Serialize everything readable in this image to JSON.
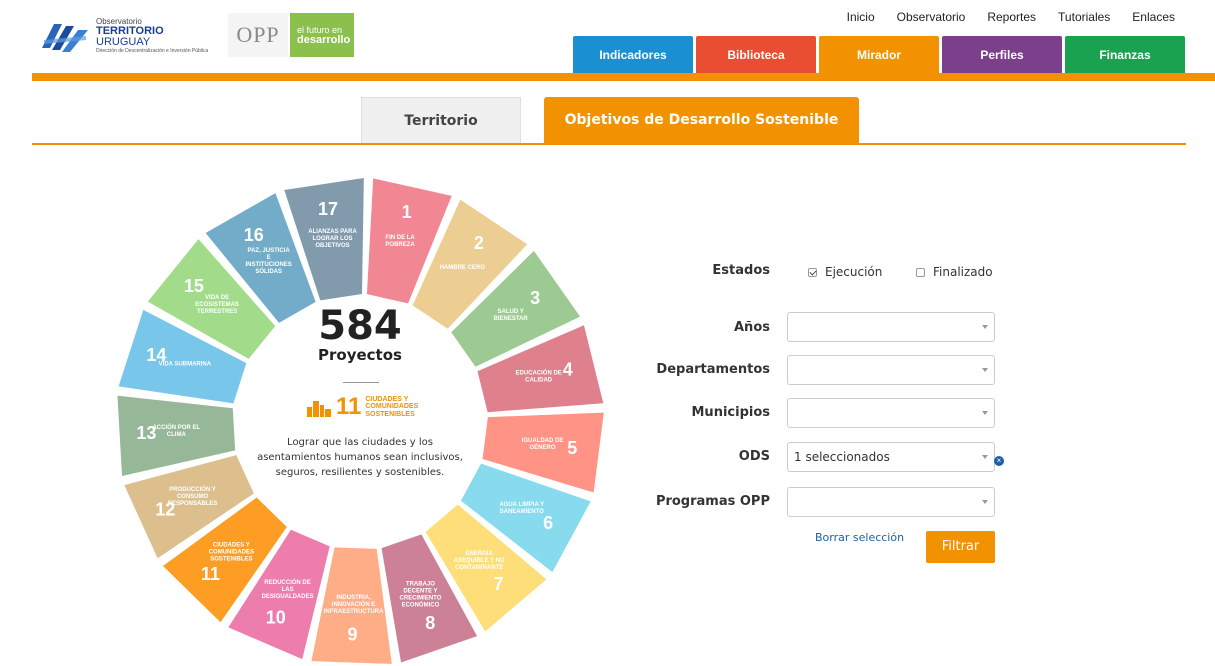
{
  "header": {
    "logo_line1": "Observatorio",
    "logo_line2_bold": "TERRITORIO",
    "logo_line2_rest": " URUGUAY",
    "logo_line3": "Dirección de Descentralización e Inversión Pública",
    "opp_logo": "OPP",
    "futuro_line1": "el futuro en",
    "futuro_line2": "desarrollo"
  },
  "topnav": [
    "Inicio",
    "Observatorio",
    "Reportes",
    "Tutoriales",
    "Enlaces"
  ],
  "maintabs": [
    {
      "label": "Indicadores",
      "color": "#1a8fd1"
    },
    {
      "label": "Biblioteca",
      "color": "#e94e32"
    },
    {
      "label": "Mirador",
      "color": "#f39200"
    },
    {
      "label": "Perfiles",
      "color": "#7b3f8c"
    },
    {
      "label": "Finanzas",
      "color": "#1aa251"
    }
  ],
  "subtabs": {
    "territorio": "Territorio",
    "ods": "Objetivos de Desarrollo Sostenible"
  },
  "wheel": {
    "total": "584",
    "total_label": "Proyectos",
    "selected_number": "11",
    "selected_title": "CIUDADES Y COMUNIDADES SOSTENIBLES",
    "selected_desc": "Lograr que las ciudades y los asentamientos humanos sean inclusivos, seguros, resilientes y sostenibles.",
    "goals": [
      {
        "n": "1",
        "label": "FIN DE LA POBREZA",
        "color": "#e5243b"
      },
      {
        "n": "2",
        "label": "HAMBRE CERO",
        "color": "#dda63a"
      },
      {
        "n": "3",
        "label": "SALUD Y BIENESTAR",
        "color": "#4c9f38"
      },
      {
        "n": "4",
        "label": "EDUCACIÓN DE CALIDAD",
        "color": "#c5192d"
      },
      {
        "n": "5",
        "label": "IGUALDAD DE GÉNERO",
        "color": "#ff3a21"
      },
      {
        "n": "6",
        "label": "AGUA LIMPIA Y SANEAMIENTO",
        "color": "#26bde2"
      },
      {
        "n": "7",
        "label": "ENERGÍA ASEQUIBLE Y NO CONTAMINANTE",
        "color": "#fcc30b"
      },
      {
        "n": "8",
        "label": "TRABAJO DECENTE Y CRECIMIENTO ECONÓMICO",
        "color": "#a21942"
      },
      {
        "n": "9",
        "label": "INDUSTRIA, INNOVACIÓN E INFRAESTRUCTURA",
        "color": "#fd6925"
      },
      {
        "n": "10",
        "label": "REDUCCIÓN DE LAS DESIGUALDADES",
        "color": "#dd1367"
      },
      {
        "n": "11",
        "label": "CIUDADES Y COMUNIDADES SOSTENIBLES",
        "color": "#fd9d24"
      },
      {
        "n": "12",
        "label": "PRODUCCIÓN Y CONSUMO RESPONSABLES",
        "color": "#bf8b2e"
      },
      {
        "n": "13",
        "label": "ACCIÓN POR EL CLIMA",
        "color": "#3f7e44"
      },
      {
        "n": "14",
        "label": "VIDA SUBMARINA",
        "color": "#0a97d9"
      },
      {
        "n": "15",
        "label": "VIDA DE ECOSISTEMAS TERRESTRES",
        "color": "#56c02b"
      },
      {
        "n": "16",
        "label": "PAZ, JUSTICIA E INSTITUCIONES SÓLIDAS",
        "color": "#00689d"
      },
      {
        "n": "17",
        "label": "ALIANZAS PARA LOGRAR LOS OBJETIVOS",
        "color": "#19486a"
      }
    ]
  },
  "form": {
    "estados_label": "Estados",
    "ejecucion": "Ejecución",
    "finalizado": "Finalizado",
    "anios_label": "Años",
    "departamentos_label": "Departamentos",
    "municipios_label": "Municipios",
    "ods_label": "ODS",
    "ods_value": "1 seleccionados",
    "programas_label": "Programas OPP",
    "clear_label": "Borrar selección",
    "filter_label": "Filtrar"
  }
}
